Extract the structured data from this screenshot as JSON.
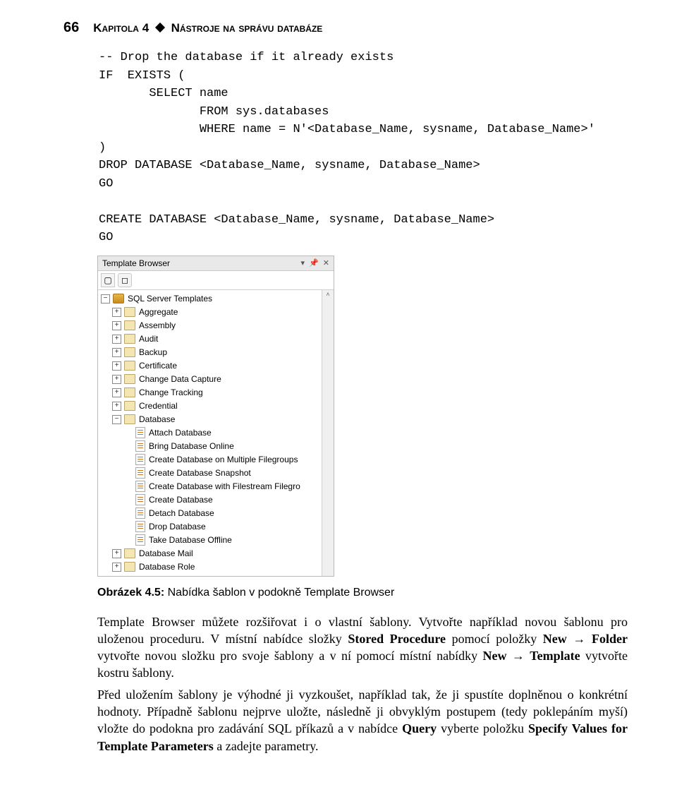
{
  "header": {
    "page_number": "66",
    "chapter_label": "Kapitola 4",
    "chapter_title": "Nástroje na správu databáze"
  },
  "codeblock": "-- Drop the database if it already exists\nIF  EXISTS (\n       SELECT name\n              FROM sys.databases\n              WHERE name = N'<Database_Name, sysname, Database_Name>'\n)\nDROP DATABASE <Database_Name, sysname, Database_Name>\nGO\n\nCREATE DATABASE <Database_Name, sysname, Database_Name>\nGO",
  "template_browser": {
    "title": "Template Browser",
    "tree": {
      "root": "SQL Server Templates",
      "folders_collapsed": [
        "Aggregate",
        "Assembly",
        "Audit",
        "Backup",
        "Certificate",
        "Change Data Capture",
        "Change Tracking",
        "Credential"
      ],
      "folder_expanded": {
        "name": "Database",
        "items": [
          "Attach Database",
          "Bring Database Online",
          "Create Database on Multiple Filegroups",
          "Create Database Snapshot",
          "Create Database with Filestream Filegro",
          "Create Database",
          "Detach Database",
          "Drop Database",
          "Take Database Offline"
        ]
      },
      "folders_after": [
        "Database Mail",
        "Database Role"
      ]
    }
  },
  "figure_caption": {
    "label": "Obrázek 4.5:",
    "text": "Nabídka šablon v podokně Template Browser"
  },
  "paragraphs": {
    "p1_a": "Template Browser můžete rozšiřovat i o vlastní šablony. Vytvořte například novou šablonu pro uloženou proceduru. V místní nabídce složky ",
    "p1_b1": "Stored Procedure",
    "p1_c": " pomocí položky ",
    "p1_b2": "New",
    "p1_arrow1": " → ",
    "p1_b3": "Folder",
    "p1_d": " vytvořte novou složku pro svoje šablony a v ní pomocí místní nabídky ",
    "p1_b4": "New",
    "p1_arrow2": " → ",
    "p1_b5": "Template",
    "p1_e": " vytvořte kostru šablony.",
    "p2_a": "Před uložením šablony je výhodné ji vyzkoušet, například tak, že ji spustíte doplněnou o konkrétní hodnoty. Případně šablonu nejprve uložte, následně ji obvyklým postupem (tedy poklepáním myší) vložte do podokna pro zadávání SQL příkazů a v nabídce ",
    "p2_b1": "Query",
    "p2_b": " vyberte položku ",
    "p2_b2": "Specify Values for Template Parameters",
    "p2_c": " a zadejte parametry."
  }
}
